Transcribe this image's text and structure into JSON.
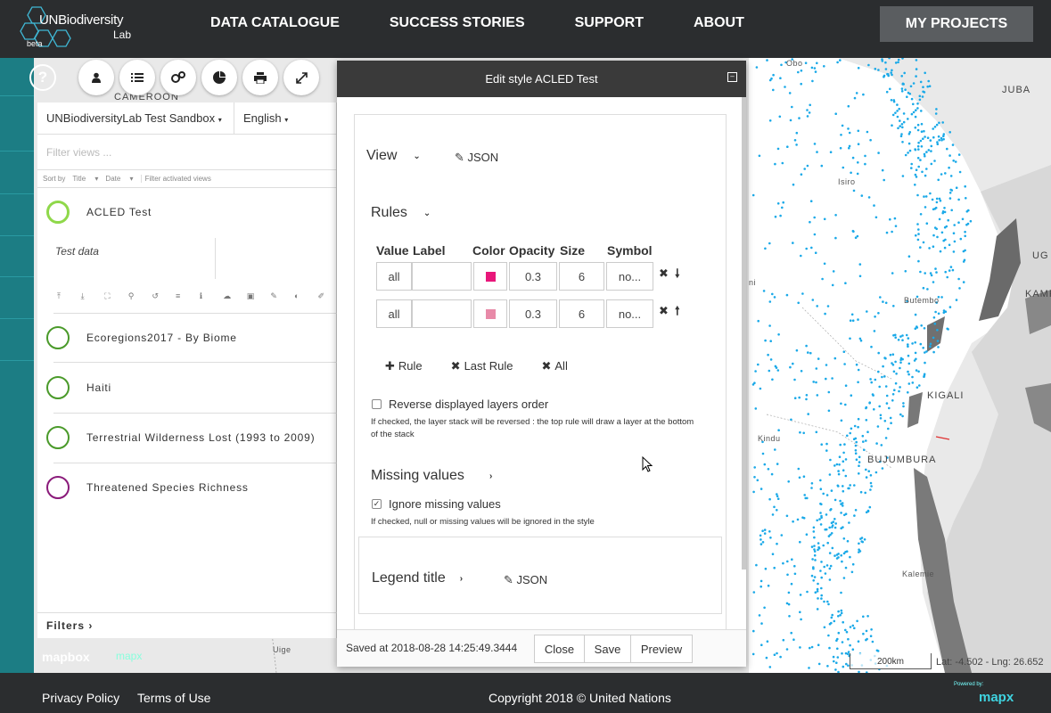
{
  "header": {
    "logo_main": "UNBiodiversity",
    "logo_sub": "Lab",
    "logo_beta": "beta",
    "nav": [
      "DATA CATALOGUE",
      "SUCCESS STORIES",
      "SUPPORT",
      "ABOUT"
    ],
    "my_projects": "MY PROJECTS"
  },
  "toolbar": {
    "help": "?",
    "icons": [
      "user-icon",
      "list-icon",
      "layers-settings-icon",
      "pie-chart-icon",
      "print-icon",
      "expand-icon"
    ]
  },
  "map": {
    "labels": {
      "cameroon": "CAMEROON",
      "obo": "Obo",
      "juba": "JUBA",
      "isiro": "Isiro",
      "ug": "UG",
      "kamp": "KAMP",
      "butembo": "Butembo",
      "kigali": "KIGALI",
      "kindu": "Kindu",
      "bujumbura": "BUJUMBURA",
      "kalemie": "Kalemie",
      "uige": "Uige",
      "ni": "ni"
    },
    "scale": "200km",
    "coords": "Lat: -4.502 - Lng: 26.652",
    "mapbox": "mapbox",
    "mapx": "mapx",
    "point_color": "#1aa9e8"
  },
  "panel": {
    "project": "UNBiodiversityLab Test Sandbox",
    "language": "English",
    "filter_placeholder": "Filter views ...",
    "sort_by": "Sort by",
    "sort_title": "Title",
    "sort_date": "Date",
    "filter_activated": "Filter activated views",
    "views": [
      {
        "title": "ACLED Test",
        "color": "#8fd84a"
      },
      {
        "title": "Ecoregions2017 - By Biome",
        "color": "#4a9a2a"
      },
      {
        "title": "Haiti",
        "color": "#4a9a2a"
      },
      {
        "title": "Terrestrial Wilderness Lost (1993 to 2009)",
        "color": "#4a9a2a"
      },
      {
        "title": "Threatened Species Richness",
        "color": "#8a1a7a"
      }
    ],
    "description": "Test data",
    "filters": "Filters"
  },
  "modal": {
    "title": "Edit style ACLED Test",
    "view_label": "View",
    "json_label": "JSON",
    "rules_label": "Rules",
    "columns": [
      "Value",
      "Label",
      "Color",
      "Opacity",
      "Size",
      "Symbol"
    ],
    "rules": [
      {
        "value": "all",
        "label": "",
        "color": "#e8177a",
        "opacity": "0.3",
        "size": "6",
        "symbol": "no..."
      },
      {
        "value": "all",
        "label": "",
        "color": "#e88aa8",
        "opacity": "0.3",
        "size": "6",
        "symbol": "no..."
      }
    ],
    "add_rule": "Rule",
    "last_rule": "Last Rule",
    "all": "All",
    "reverse_label": "Reverse displayed layers order",
    "reverse_note": "If checked, the layer stack will be reversed : the top rule will draw a layer at the bottom of the stack",
    "missing_label": "Missing values",
    "ignore_label": "Ignore missing values",
    "ignore_note": "If checked, null or missing values will be ignored in the style",
    "legend_title": "Legend title",
    "saved_at": "Saved at 2018-08-28 14:25:49.3444",
    "close": "Close",
    "save": "Save",
    "preview": "Preview"
  },
  "footer": {
    "privacy": "Privacy Policy",
    "terms": "Terms of Use",
    "copyright": "Copyright 2018 © United Nations",
    "powered": "Powered by:",
    "mapx": "mapx"
  }
}
